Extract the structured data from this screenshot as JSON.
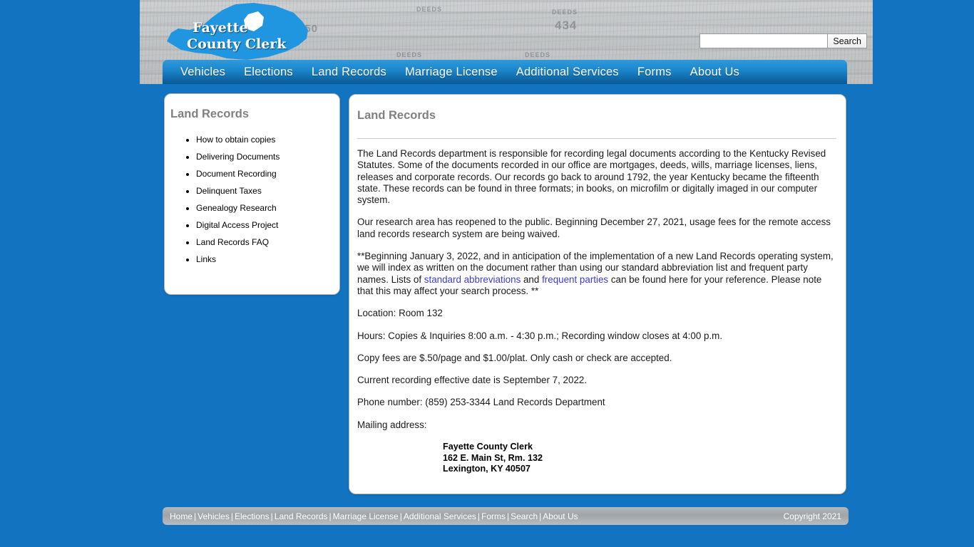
{
  "site": {
    "background_color": "#1273c0",
    "logo": {
      "line1": "Fayette",
      "line2": "County Clerk",
      "shape_color": "#2196e0"
    },
    "header_ledger_marks": [
      "450",
      "434",
      "DEEDS",
      "DEEDS",
      "DEEDS",
      "DEEDS",
      "DEEDS",
      "DEEDS"
    ]
  },
  "search": {
    "value": "",
    "placeholder": "",
    "button_label": "Search"
  },
  "nav": {
    "items": [
      {
        "label": "Vehicles"
      },
      {
        "label": "Elections"
      },
      {
        "label": "Land Records"
      },
      {
        "label": "Marriage License"
      },
      {
        "label": "Additional Services"
      },
      {
        "label": "Forms"
      },
      {
        "label": "About Us"
      }
    ]
  },
  "sidebar": {
    "title": "Land Records",
    "items": [
      {
        "label": "How to obtain copies"
      },
      {
        "label": "Delivering Documents"
      },
      {
        "label": "Document Recording"
      },
      {
        "label": "Delinquent Taxes"
      },
      {
        "label": "Genealogy Research"
      },
      {
        "label": "Digital Access Project"
      },
      {
        "label": "Land Records FAQ"
      },
      {
        "label": "Links"
      }
    ]
  },
  "main": {
    "title": "Land Records",
    "paragraph_1": "The Land Records department is responsible for recording legal documents according to the Kentucky Revised Statutes. Some of the documents recorded in our office are mortgages, deeds, wills, marriage licenses, liens, releases and corporate records. Our records go back to around 1792, the year Kentucky became the fifteenth state. These records can be found in three formats; in books, on microfilm or digitally imaged in our computer system.",
    "paragraph_2": "Our research area has reopened to the public.  Beginning December 27, 2021, usage fees for the remote access land records research system are being waived.",
    "paragraph_3_part_a": "**Beginning January 3, 2022, and in anticipation of the implementation of a new Land Records operating system, we will index as written on the document rather than using our standard abbreviation list and frequent party names.  Lists of ",
    "paragraph_3_link_1": "standard abbreviations",
    "paragraph_3_part_b": " and ",
    "paragraph_3_link_2": "frequent parties",
    "paragraph_3_part_c": " can be found here for your reference.  Please note that this may affect your search process. **",
    "location": "Location: Room 132",
    "hours": "Hours: Copies & Inquiries 8:00 a.m. - 4:30 p.m.; Recording window closes at 4:00 p.m.",
    "copy_fees": "Copy fees are $.50/page and $1.00/plat.  Only cash or check are accepted.",
    "effective_date": "Current recording effective date is September 7, 2022.",
    "phone": "Phone number: (859) 253-3344 Land Records Department",
    "mailing_label": "Mailing address:",
    "address_line_1": "Fayette County Clerk",
    "address_line_2": "162 E. Main St, Rm. 132",
    "address_line_3": "Lexington, KY 40507",
    "link_color": "#3b3bd0"
  },
  "footer": {
    "links": [
      {
        "label": "Home"
      },
      {
        "label": "Vehicles"
      },
      {
        "label": "Elections"
      },
      {
        "label": "Land Records"
      },
      {
        "label": "Marriage License"
      },
      {
        "label": "Additional Services"
      },
      {
        "label": "Forms"
      },
      {
        "label": "Search"
      },
      {
        "label": "About Us"
      }
    ],
    "separator": "|",
    "copyright": "Copyright 2021"
  }
}
